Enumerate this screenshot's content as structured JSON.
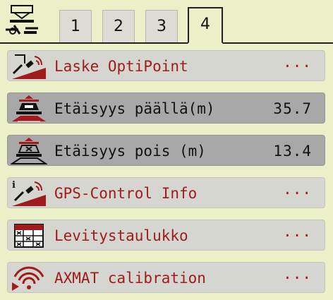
{
  "header": {
    "icon": "spreader-settings-icon",
    "tabs": [
      "1",
      "2",
      "3",
      "4"
    ],
    "active_tab": "4"
  },
  "menu": {
    "items": [
      {
        "icon": "optipoint-calc-icon",
        "label": "Laske OptiPoint",
        "value": "···",
        "selected": false
      },
      {
        "icon": "distance-on-icon",
        "label": "Etäisyys päällä(m)",
        "value": "35.7",
        "selected": true
      },
      {
        "icon": "distance-off-icon",
        "label": "Etäisyys pois (m)",
        "value": "13.4",
        "selected": true
      },
      {
        "icon": "gps-info-icon",
        "label": "GPS-Control Info",
        "value": "···",
        "selected": false
      },
      {
        "icon": "spread-chart-icon",
        "label": "Levitystaulukko",
        "value": "···",
        "selected": false
      },
      {
        "icon": "axmat-wifi-icon",
        "label": "AXMAT calibration",
        "value": "···",
        "selected": false
      }
    ]
  },
  "colors": {
    "background": "#ecf0c8",
    "row": "#d6d6d0",
    "row_selected": "#a8a8a8",
    "label_red": "#a01c1c"
  }
}
